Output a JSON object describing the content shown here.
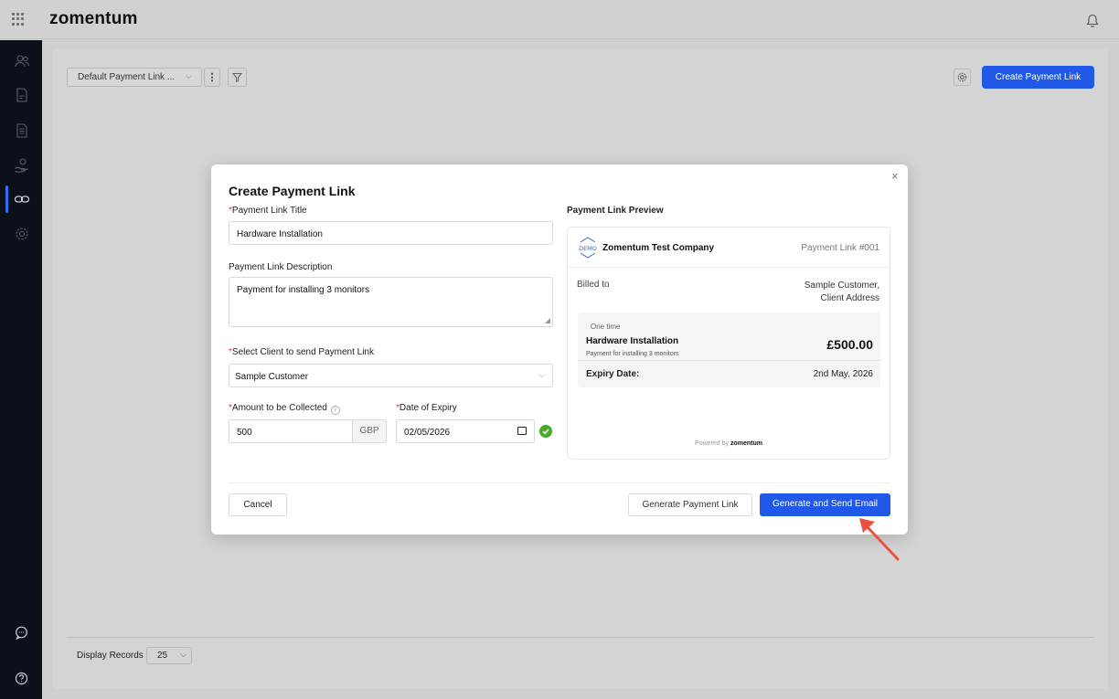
{
  "app": {
    "brand": "zomentum"
  },
  "toolbar": {
    "view_select": "Default Payment Link ...",
    "kebab": "⋮",
    "create_button": "Create Payment Link"
  },
  "footer": {
    "display_label": "Display Records",
    "display_value": "25"
  },
  "modal": {
    "title": "Create Payment Link",
    "close": "×",
    "title_label": "Payment Link Title",
    "title_value": "Hardware Installation",
    "description_label": "Payment Link Description",
    "description_value": "Payment for installing 3 monitors",
    "client_label": "Select Client to send Payment Link",
    "client_value": "Sample Customer",
    "amount_label": "Amount to be Collected",
    "amount_value": "500",
    "currency": "GBP",
    "expiry_label": "Date of Expiry",
    "expiry_value": "02/05/2026",
    "required_mark": "*",
    "buttons": {
      "cancel": "Cancel",
      "generate": "Generate Payment Link",
      "generate_send": "Generate and Send Email"
    }
  },
  "preview": {
    "heading": "Payment Link Preview",
    "company": "Zomentum Test Company",
    "logo_text": "DEMO",
    "link_number": "Payment Link #001",
    "billed_to_label": "Billed to",
    "customer_name": "Sample Customer,",
    "customer_address": "Client Address",
    "frequency": "One time",
    "item_name": "Hardware Installation",
    "item_description": "Payment for installing 3 monitors",
    "amount": "£500.00",
    "expiry_label": "Expiry Date:",
    "expiry_value": "2nd May, 2026",
    "powered_by": "Powered by",
    "powered_brand": "zomentum"
  },
  "colors": {
    "primary": "#2058e8",
    "success": "#4aaa28",
    "required": "#e33333",
    "arrow": "#e8533f"
  },
  "icons": [
    "apps-grid-icon",
    "bell-icon",
    "users-icon",
    "document-icon",
    "invoice-icon",
    "hand-coin-icon",
    "link-icon",
    "gear-icon",
    "filter-icon",
    "chat-icon",
    "help-icon",
    "calendar-icon",
    "check-circle-icon",
    "info-icon"
  ]
}
